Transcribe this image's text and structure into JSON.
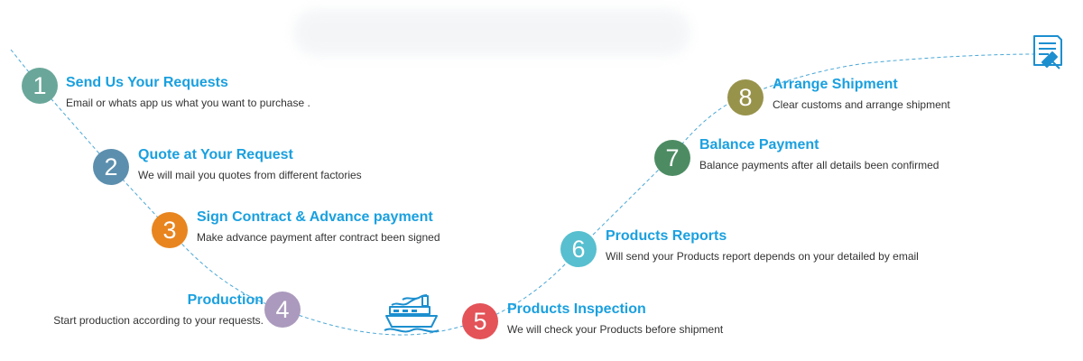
{
  "theme": {
    "title_color": "#1aa0df",
    "path_color": "#4aa7d6",
    "icon_color": "#1c8fcf"
  },
  "steps": [
    {
      "number": "1",
      "title": "Send Us Your Requests",
      "desc": "Email or whats app us what you want to purchase .",
      "color": "#6aa79a"
    },
    {
      "number": "2",
      "title": "Quote at Your Request",
      "desc": "We will mail you quotes from different factories",
      "color": "#5c8fae"
    },
    {
      "number": "3",
      "title": "Sign Contract & Advance payment",
      "desc": "Make advance payment after contract been signed",
      "color": "#e8851f"
    },
    {
      "number": "4",
      "title": "Production",
      "desc": "Start production according to your requests.",
      "color": "#ab9abd"
    },
    {
      "number": "5",
      "title": "Products Inspection",
      "desc": "We will check your Products before shipment",
      "color": "#e35358"
    },
    {
      "number": "6",
      "title": "Products Reports",
      "desc": "Will send your Products report depends on your detailed by email",
      "color": "#57bfcf"
    },
    {
      "number": "7",
      "title": "Balance Payment",
      "desc": "Balance payments after all details been confirmed",
      "color": "#4d8c63"
    },
    {
      "number": "8",
      "title": "Arrange Shipment",
      "desc": "Clear customs and arrange shipment",
      "color": "#98934b"
    }
  ],
  "icons": {
    "ship": "ship-icon",
    "document": "contract-document-icon"
  }
}
